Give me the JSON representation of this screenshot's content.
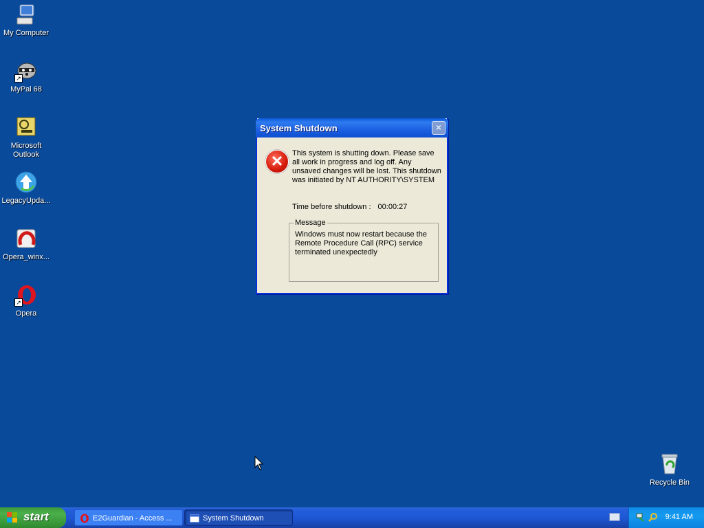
{
  "desktop": {
    "icons": [
      {
        "label": "My Computer"
      },
      {
        "label": "MyPal 68"
      },
      {
        "label": "Microsoft Outlook"
      },
      {
        "label": "LegacyUpda..."
      },
      {
        "label": "Opera_winx..."
      },
      {
        "label": "Opera"
      },
      {
        "label": "Recycle Bin"
      }
    ]
  },
  "dialog": {
    "title": "System Shutdown",
    "close_label": "×",
    "body": "This system is shutting down. Please save all work in progress and log off. Any unsaved changes will be lost. This shutdown was initiated by NT AUTHORITY\\SYSTEM",
    "time_label": "Time before shutdown :",
    "time_value": "00:00:27",
    "message_legend": "Message",
    "message_text": "Windows must now restart because the Remote Procedure Call (RPC) service terminated unexpectedly"
  },
  "taskbar": {
    "start_label": "start",
    "tasks": [
      {
        "label": "E2Guardian - Access ..."
      },
      {
        "label": "System Shutdown"
      }
    ],
    "clock": "9:41 AM"
  },
  "colors": {
    "desktop_bg": "#0a4a9a",
    "title_bar": "#1c60e2",
    "dialog_bg": "#ece9d8",
    "error_red": "#d41a0a",
    "start_green": "#4bb04b"
  }
}
